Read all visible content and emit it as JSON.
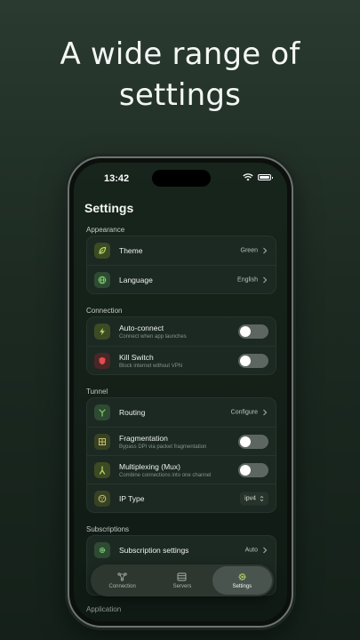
{
  "headline": {
    "line1": "A wide range of",
    "line2": "settings"
  },
  "status_bar": {
    "time": "13:42"
  },
  "page_title": "Settings",
  "sections": {
    "appearance": "Appearance",
    "connection": "Connection",
    "tunnel": "Tunnel",
    "subscriptions": "Subscriptions",
    "application": "Application"
  },
  "appearance": {
    "theme": {
      "label": "Theme",
      "value": "Green"
    },
    "language": {
      "label": "Language",
      "value": "English"
    }
  },
  "connection": {
    "auto_connect": {
      "label": "Auto-connect",
      "sub": "Connect when app launches",
      "on": false
    },
    "kill_switch": {
      "label": "Kill Switch",
      "sub": "Block internet without VPN",
      "on": false
    }
  },
  "tunnel": {
    "routing": {
      "label": "Routing",
      "value": "Configure"
    },
    "fragmentation": {
      "label": "Fragmentation",
      "sub": "Bypass DPI via packet fragmentation",
      "on": false
    },
    "mux": {
      "label": "Multiplexing (Mux)",
      "sub": "Combine connections into one channel",
      "on": false
    },
    "ip_type": {
      "label": "IP Type",
      "value": "ipv4"
    }
  },
  "subscriptions": {
    "settings": {
      "label": "Subscription settings",
      "value": "Auto"
    }
  },
  "tabbar": {
    "connection": "Connection",
    "servers": "Servers",
    "settings": "Settings"
  },
  "icons": {
    "theme": "leaf-icon",
    "language": "globe-icon",
    "auto_connect": "bolt-icon",
    "kill_switch": "shield-icon",
    "routing": "fork-icon",
    "fragmentation": "grid-icon",
    "mux": "merge-icon",
    "ip_type": "network-icon",
    "subscription": "gear-icon"
  },
  "colors": {
    "accent": "#7fd36b",
    "background": "#1c2a22",
    "card": "#1c2922"
  }
}
